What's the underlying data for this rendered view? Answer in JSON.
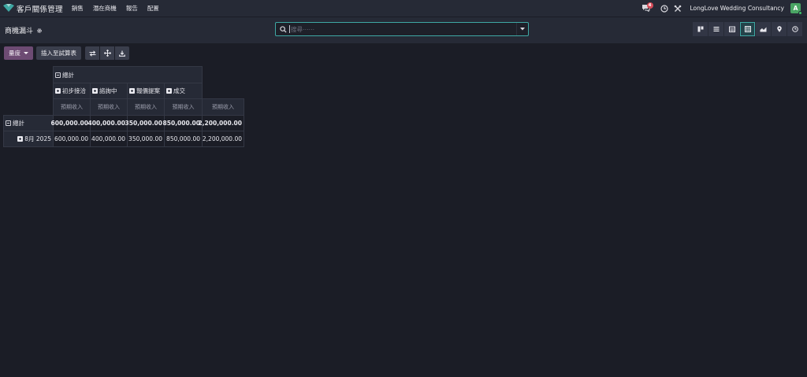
{
  "navbar": {
    "app_title": "客戶關係管理",
    "menu": [
      "銷售",
      "潛在商機",
      "報告",
      "配置"
    ],
    "chat_count": "4",
    "company": "LongLove Wedding Consultancy",
    "avatar_initial": "A"
  },
  "control_panel": {
    "page_title": "商機漏斗",
    "search_placeholder": "搜尋⋯⋯",
    "views": [
      "kanban",
      "list",
      "calendar",
      "pivot",
      "graph",
      "map",
      "activity"
    ],
    "active_view": "pivot"
  },
  "toolbar": {
    "measures_label": "量度",
    "insert_sheet_label": "插入至試算表"
  },
  "pivot": {
    "col_total": "總計",
    "stages": [
      "初步接洽",
      "諮詢中",
      "報價提案",
      "成交"
    ],
    "measure": "預期收入",
    "rows": [
      {
        "label": "總計",
        "values": [
          "600,000.00",
          "400,000.00",
          "350,000.00",
          "850,000.00",
          "2,200,000.00"
        ]
      },
      {
        "label": "8月 2025",
        "values": [
          "600,000.00",
          "400,000.00",
          "350,000.00",
          "850,000.00",
          "2,200,000.00"
        ]
      }
    ]
  },
  "colors": {
    "background": "#1b1d26",
    "navbar": "#262a36",
    "primary": "#6d4b73",
    "accent": "#3ea8a4",
    "badge": "#d44c59",
    "avatar": "#4aa564"
  }
}
